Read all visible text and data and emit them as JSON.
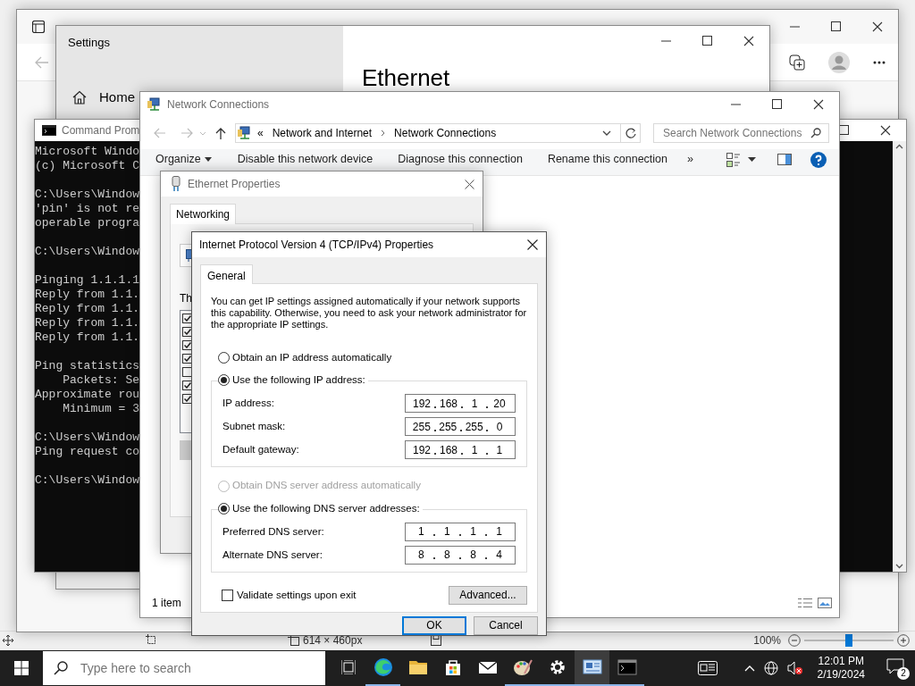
{
  "paint": {
    "status": {
      "size": "614 × 460px",
      "zoom": "100%",
      "zoom_slider": {
        "level": 0.5
      }
    }
  },
  "settings": {
    "title": "Settings",
    "nav": [
      {
        "label": "Home"
      }
    ],
    "heading": "Ethernet"
  },
  "console": {
    "title": "Command Prom",
    "blocks": [
      [
        "Microsoft Windo",
        "(c) Microsoft C"
      ],
      [
        "C:\\Users\\Window",
        "'pin' is not re",
        "operable progra"
      ],
      [
        "C:\\Users\\Window"
      ],
      [
        "Pinging 1.1.1.1",
        "Reply from 1.1.",
        "Reply from 1.1.",
        "Reply from 1.1.",
        "Reply from 1.1."
      ],
      [
        "Ping statistics",
        "    Packets: Se",
        "Approximate rou",
        "    Minimum = 3"
      ],
      [
        "C:\\Users\\Window",
        "Ping request co"
      ],
      [
        "C:\\Users\\Window"
      ]
    ]
  },
  "network_connections": {
    "title": "Network Connections",
    "path_prefix": "«",
    "breadcrumb": [
      "Network and Internet",
      "Network Connections"
    ],
    "search": {
      "placeholder": "Search Network Connections"
    },
    "toolbar": [
      {
        "label": "Organize",
        "kind": "menu"
      },
      {
        "label": "Disable this network device",
        "kind": "command"
      },
      {
        "label": "Diagnose this connection",
        "kind": "command"
      },
      {
        "label": "Rename this connection",
        "kind": "command"
      },
      {
        "label": "»",
        "kind": "command"
      }
    ],
    "status": "1 item"
  },
  "ethernet_properties": {
    "title": "Ethernet Properties",
    "tabs": [
      {
        "label": "Networking",
        "selected": true
      }
    ],
    "list_caption": "Th",
    "components": [
      {
        "checked": true
      },
      {
        "checked": true
      },
      {
        "checked": true
      },
      {
        "checked": true
      },
      {
        "checked": false
      },
      {
        "checked": true
      },
      {
        "checked": true
      }
    ]
  },
  "ipv4": {
    "title": "Internet Protocol Version 4 (TCP/IPv4) Properties",
    "tabs": [
      {
        "label": "General",
        "selected": true
      }
    ],
    "intro": "You can get IP settings assigned automatically if your network supports this capability. Otherwise, you need to ask your network administrator for the appropriate IP settings.",
    "ip_options": [
      {
        "label": "Obtain an IP address automatically",
        "selected": false,
        "disabled": false
      },
      {
        "label": "Use the following IP address:",
        "selected": true,
        "disabled": false
      }
    ],
    "ip_fields": [
      {
        "label": "IP address:",
        "octets": [
          "192",
          "168",
          "1",
          "20"
        ]
      },
      {
        "label": "Subnet mask:",
        "octets": [
          "255",
          "255",
          "255",
          "0"
        ]
      },
      {
        "label": "Default gateway:",
        "octets": [
          "192",
          "168",
          "1",
          "1"
        ]
      }
    ],
    "dns_options": [
      {
        "label": "Obtain DNS server address automatically",
        "selected": false,
        "disabled": true
      },
      {
        "label": "Use the following DNS server addresses:",
        "selected": true,
        "disabled": false
      }
    ],
    "dns_fields": [
      {
        "label": "Preferred DNS server:",
        "octets": [
          "1",
          "1",
          "1",
          "1"
        ]
      },
      {
        "label": "Alternate DNS server:",
        "octets": [
          "8",
          "8",
          "8",
          "4"
        ]
      }
    ],
    "validate": {
      "label": "Validate settings upon exit",
      "checked": false
    },
    "buttons": [
      {
        "label": "Advanced...",
        "kind": "advanced"
      },
      {
        "label": "OK",
        "kind": "default"
      },
      {
        "label": "Cancel",
        "kind": "normal"
      }
    ]
  },
  "taskbar": {
    "search": {
      "placeholder": "Type here to search"
    },
    "apps": [
      {
        "kind": "edge",
        "open": true,
        "selected": false
      },
      {
        "kind": "explorer",
        "open": false,
        "selected": false
      },
      {
        "kind": "store",
        "open": false,
        "selected": false
      },
      {
        "kind": "mail",
        "open": false,
        "selected": false
      },
      {
        "kind": "paint",
        "open": true,
        "selected": false
      },
      {
        "kind": "settings",
        "open": true,
        "selected": false
      },
      {
        "kind": "control-panel",
        "open": true,
        "selected": true
      },
      {
        "kind": "console",
        "open": true,
        "selected": false
      }
    ],
    "time": "12:01 PM",
    "date": "2/19/2024",
    "notifications": "2"
  }
}
